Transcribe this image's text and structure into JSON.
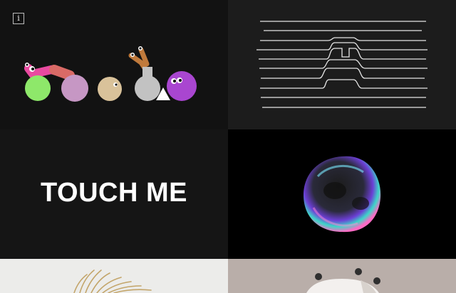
{
  "tiles": {
    "creatures": {
      "info_label": "i",
      "colors": [
        "#8ee86a",
        "#c697c4",
        "#d9c29a",
        "#c2c2c2",
        "#a946d0",
        "#e94aa0",
        "#d96a66",
        "#c07a3c"
      ]
    },
    "lines": {
      "color": "#e6e6e6"
    },
    "touch": {
      "title": "TOUCH ME"
    },
    "bubble": {
      "colors": [
        "#6c3fd6",
        "#3dd6c8",
        "#ff6ac4",
        "#1a1a1a"
      ]
    },
    "rays": {
      "color": "#c3a56a"
    },
    "dial": {
      "colors": [
        "#f3f0ee",
        "#3a3a3a"
      ]
    }
  },
  "icons": [
    "info-icon"
  ]
}
